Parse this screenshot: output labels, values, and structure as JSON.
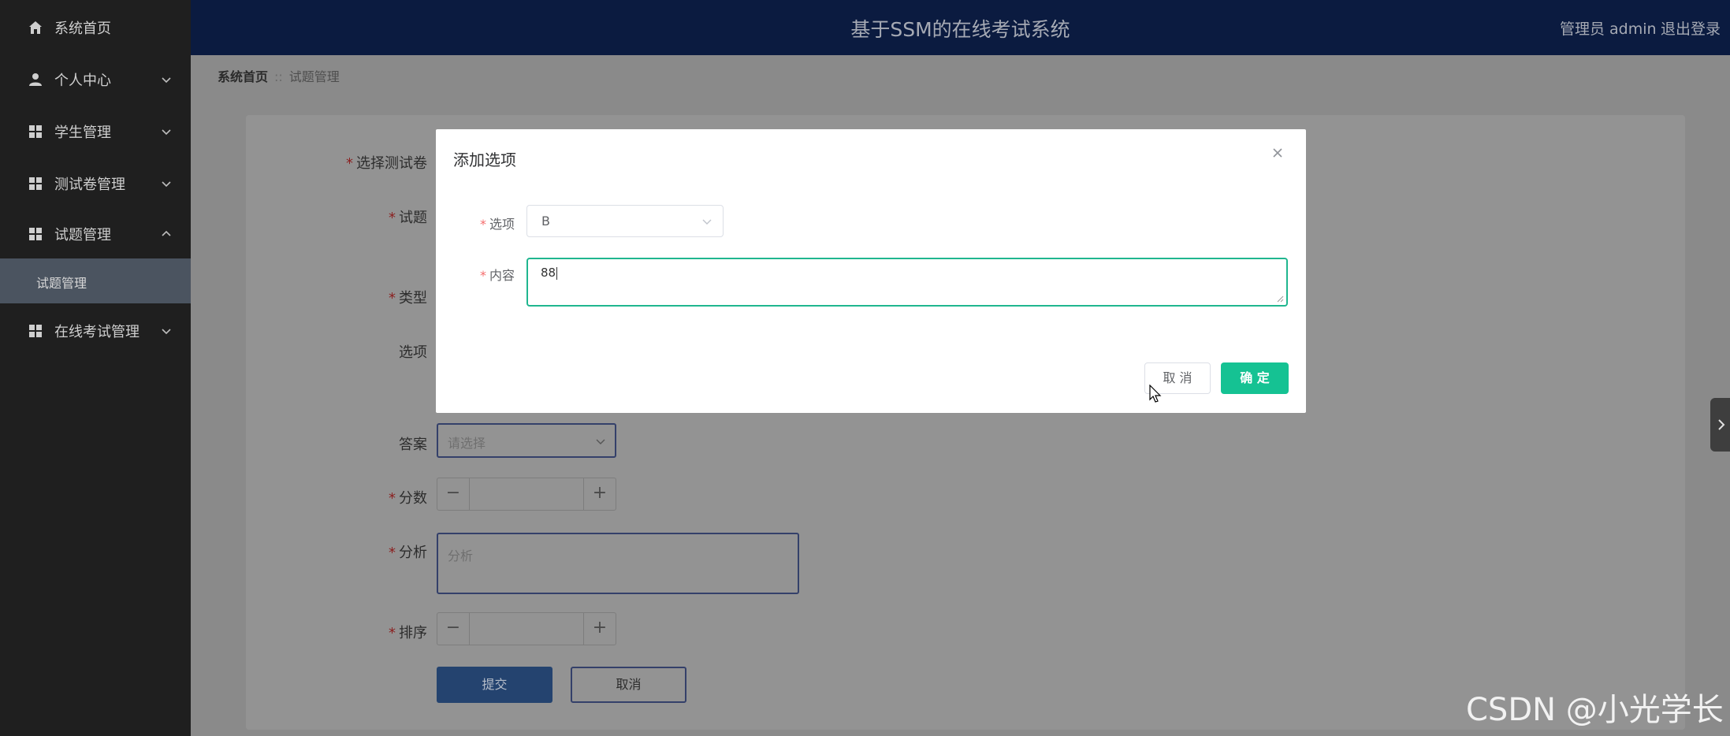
{
  "app_title": "基于SSM的在线考试系统",
  "header": {
    "user": "管理员 admin",
    "logout": "退出登录"
  },
  "sidebar": {
    "items": [
      {
        "label": "系统首页",
        "icon": "home-icon"
      },
      {
        "label": "个人中心",
        "icon": "user-icon"
      },
      {
        "label": "学生管理",
        "icon": "grid-icon"
      },
      {
        "label": "测试卷管理",
        "icon": "grid-icon"
      },
      {
        "label": "试题管理",
        "icon": "grid-icon",
        "expanded": true
      },
      {
        "label": "在线考试管理",
        "icon": "grid-icon"
      }
    ],
    "submenu": {
      "label": "试题管理"
    }
  },
  "breadcrumb": {
    "home": "系统首页",
    "separator": "::",
    "current": "试题管理"
  },
  "form": {
    "labels": {
      "paper": "选择测试卷",
      "question": "试题",
      "type": "类型",
      "options": "选项",
      "answer": "答案",
      "score": "分数",
      "analysis": "分析",
      "order": "排序"
    },
    "answer_placeholder": "请选择",
    "analysis_placeholder": "分析",
    "stepper": {
      "minus": "−",
      "plus": "+"
    },
    "submit": "提交",
    "cancel": "取消"
  },
  "modal": {
    "title": "添加选项",
    "option_label": "选项",
    "option_value": "B",
    "content_label": "内容",
    "content_value": "88",
    "cancel": "取 消",
    "confirm": "确 定"
  },
  "watermark": "CSDN @小光学长",
  "colors": {
    "header_bg": "#0b1b40",
    "sidebar_bg": "#1f1f1f",
    "accent": "#15c293",
    "required": "#f56c6c"
  }
}
